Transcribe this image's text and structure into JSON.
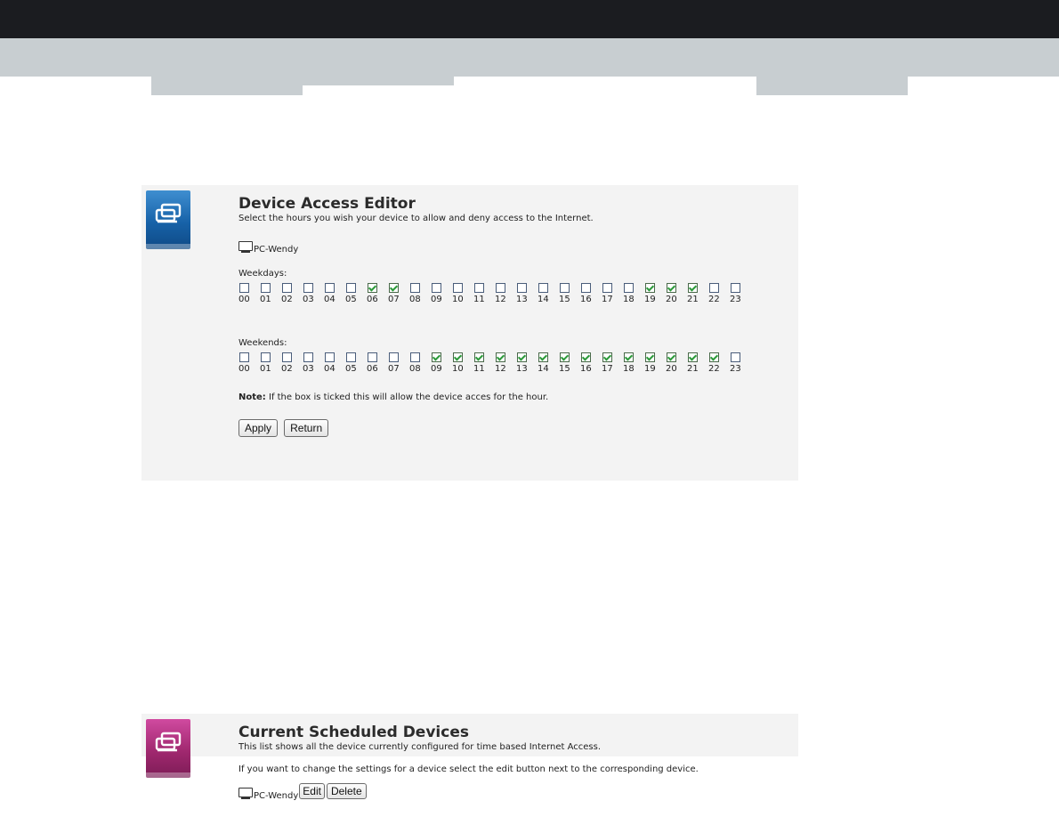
{
  "editor": {
    "title": "Device Access Editor",
    "subtitle": "Select the hours you wish your device to allow and deny access to the Internet.",
    "device_name": "PC-Wendy",
    "weekdays_label": "Weekdays:",
    "weekends_label": "Weekends:",
    "hours": [
      "00",
      "01",
      "02",
      "03",
      "04",
      "05",
      "06",
      "07",
      "08",
      "09",
      "10",
      "11",
      "12",
      "13",
      "14",
      "15",
      "16",
      "17",
      "18",
      "19",
      "20",
      "21",
      "22",
      "23"
    ],
    "weekdays_checked": [
      false,
      false,
      false,
      false,
      false,
      false,
      true,
      true,
      false,
      false,
      false,
      false,
      false,
      false,
      false,
      false,
      false,
      false,
      false,
      true,
      true,
      true,
      false,
      false
    ],
    "weekends_checked": [
      false,
      false,
      false,
      false,
      false,
      false,
      false,
      false,
      false,
      true,
      true,
      true,
      true,
      true,
      true,
      true,
      true,
      true,
      true,
      true,
      true,
      true,
      true,
      false
    ],
    "note_label": "Note:",
    "note_text": " If the box is ticked this will allow the device acces for the hour.",
    "apply_label": "Apply",
    "return_label": "Return",
    "icon": "device-access-icon",
    "accent_color": "#1762a8"
  },
  "scheduled": {
    "title": "Current Scheduled Devices",
    "subtitle": "This list shows all the device currently configured for time based Internet Access.",
    "instructions": "If you want to change the settings for a device select the edit button next to the corresponding device.",
    "device_name": "PC-Wendy",
    "edit_label": "Edit",
    "delete_label": "Delete",
    "icon": "scheduled-devices-icon",
    "accent_color": "#a0286f"
  }
}
